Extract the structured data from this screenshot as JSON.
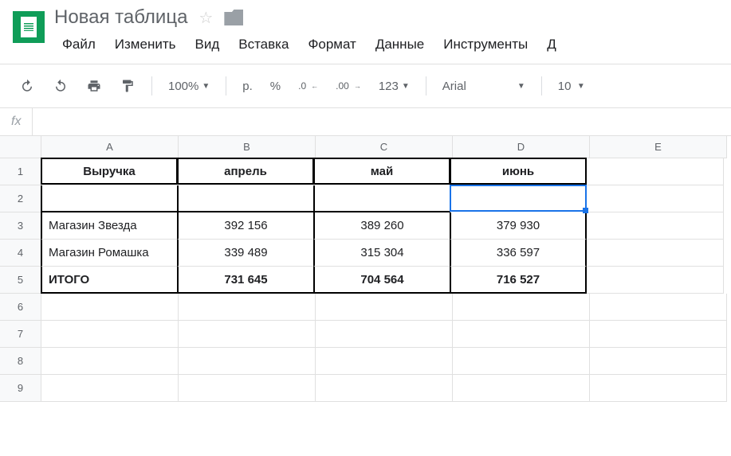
{
  "doc": {
    "title": "Новая таблица"
  },
  "menubar": [
    "Файл",
    "Изменить",
    "Вид",
    "Вставка",
    "Формат",
    "Данные",
    "Инструменты",
    "Д"
  ],
  "toolbar": {
    "zoom": "100%",
    "currency": "р.",
    "percent": "%",
    "dec_dec": ".0",
    "inc_dec": ".00",
    "more_formats": "123",
    "font": "Arial",
    "font_size": "10"
  },
  "columns": [
    "A",
    "B",
    "C",
    "D",
    "E"
  ],
  "rows": [
    "1",
    "2",
    "3",
    "4",
    "5",
    "6",
    "7",
    "8",
    "9"
  ],
  "sheet": {
    "header": {
      "a": "Выручка",
      "b": "апрель",
      "c": "май",
      "d": "июнь"
    },
    "row3": {
      "a": "Магазин Звезда",
      "b": "392 156",
      "c": "389 260",
      "d": "379 930"
    },
    "row4": {
      "a": "Магазин Ромашка",
      "b": "339 489",
      "c": "315 304",
      "d": "336 597"
    },
    "row5": {
      "a": "ИТОГО",
      "b": "731 645",
      "c": "704 564",
      "d": "716 527"
    }
  },
  "chart_data": {
    "type": "table",
    "title": "Выручка",
    "categories": [
      "апрель",
      "май",
      "июнь"
    ],
    "series": [
      {
        "name": "Магазин Звезда",
        "values": [
          392156,
          389260,
          379930
        ]
      },
      {
        "name": "Магазин Ромашка",
        "values": [
          339489,
          315304,
          336597
        ]
      },
      {
        "name": "ИТОГО",
        "values": [
          731645,
          704564,
          716527
        ]
      }
    ]
  }
}
